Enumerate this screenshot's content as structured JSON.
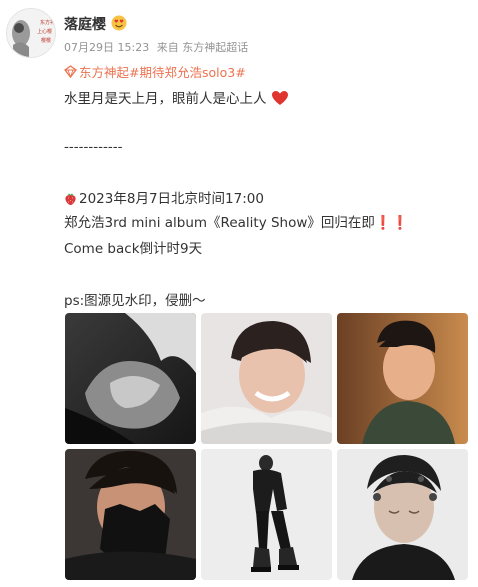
{
  "post": {
    "username": "落庭樱",
    "date": "07月29日 15:23",
    "source": "来自 东方神起超话",
    "topic_tag": "东方神起#期待郑允浩solo3#",
    "text_line_1": "水里月是天上月，眼前人是心上人",
    "separator": "------------",
    "date_line": "2023年8月7日北京时间17:00",
    "album_line": "郑允浩3rd mini album《Reality Show》回归在即",
    "exclaim": "❗❗",
    "countdown": "Come back倒计时9天",
    "ps_line": "ps:图源见水印，侵删～"
  },
  "avatar_text": "东方神起 上心樱樱",
  "icons": {
    "user_badge": "heart-eyes-face-icon",
    "topic": "supertopic-diamond-icon",
    "heart": "red-heart-icon",
    "strawberry": "strawberry-icon"
  },
  "colors": {
    "topic": "#eb7350",
    "heart": "#e0352f",
    "meta": "#939393",
    "text": "#333333"
  },
  "photos": [
    {
      "name": "photo-1",
      "description": "black-white-pose"
    },
    {
      "name": "photo-2",
      "description": "smiling-portrait"
    },
    {
      "name": "photo-3",
      "description": "warm-tone-portrait"
    },
    {
      "name": "photo-4",
      "description": "gloved-hand-face"
    },
    {
      "name": "photo-5",
      "description": "full-body-black-outfit"
    },
    {
      "name": "photo-6",
      "description": "face-with-sensors"
    }
  ]
}
